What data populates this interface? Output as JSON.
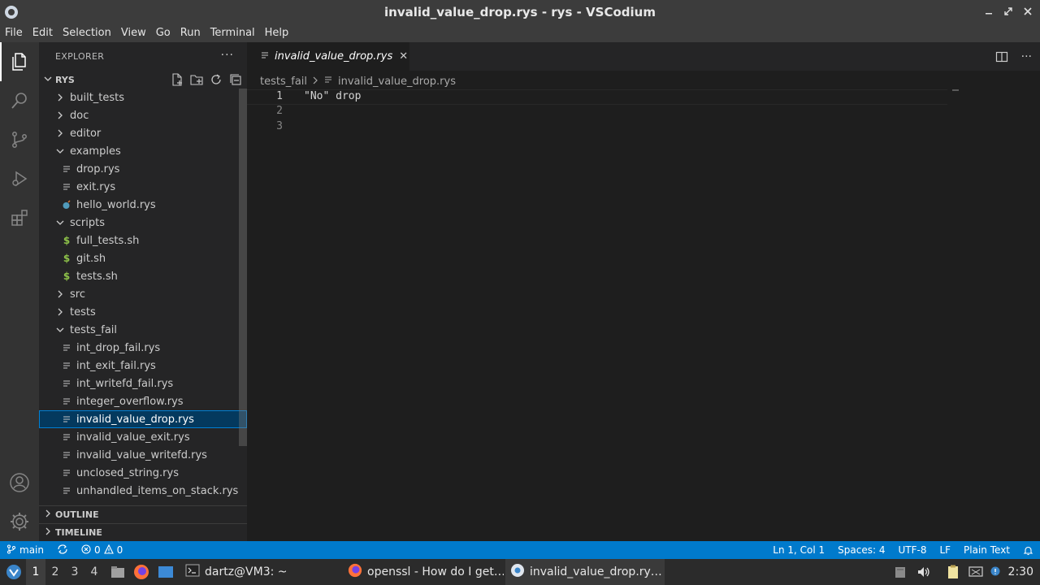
{
  "window": {
    "title": "invalid_value_drop.rys - rys - VSCodium",
    "controls": [
      "minimize",
      "maximize",
      "close"
    ]
  },
  "menu": [
    "File",
    "Edit",
    "Selection",
    "View",
    "Go",
    "Run",
    "Terminal",
    "Help"
  ],
  "activity_bar": {
    "top": [
      "files-icon",
      "search-icon",
      "source-control-icon",
      "run-debug-icon",
      "extensions-icon"
    ],
    "bottom": [
      "account-icon",
      "manage-gear-icon"
    ]
  },
  "explorer": {
    "header": "EXPLORER",
    "more": "···",
    "root": "RYS",
    "items": [
      {
        "label": "built_tests",
        "type": "folder",
        "expanded": false,
        "depth": 0
      },
      {
        "label": "doc",
        "type": "folder",
        "expanded": false,
        "depth": 0
      },
      {
        "label": "editor",
        "type": "folder",
        "expanded": false,
        "depth": 0
      },
      {
        "label": "examples",
        "type": "folder",
        "expanded": true,
        "depth": 0
      },
      {
        "label": "drop.rys",
        "type": "text",
        "depth": 1
      },
      {
        "label": "exit.rys",
        "type": "text",
        "depth": 1
      },
      {
        "label": "hello_world.rys",
        "type": "special",
        "depth": 1
      },
      {
        "label": "scripts",
        "type": "folder",
        "expanded": true,
        "depth": 0
      },
      {
        "label": "full_tests.sh",
        "type": "shell",
        "depth": 1
      },
      {
        "label": "git.sh",
        "type": "shell",
        "depth": 1
      },
      {
        "label": "tests.sh",
        "type": "shell",
        "depth": 1
      },
      {
        "label": "src",
        "type": "folder",
        "expanded": false,
        "depth": 0
      },
      {
        "label": "tests",
        "type": "folder",
        "expanded": false,
        "depth": 0
      },
      {
        "label": "tests_fail",
        "type": "folder",
        "expanded": true,
        "depth": 0
      },
      {
        "label": "int_drop_fail.rys",
        "type": "text",
        "depth": 1
      },
      {
        "label": "int_exit_fail.rys",
        "type": "text",
        "depth": 1
      },
      {
        "label": "int_writefd_fail.rys",
        "type": "text",
        "depth": 1
      },
      {
        "label": "integer_overflow.rys",
        "type": "text",
        "depth": 1
      },
      {
        "label": "invalid_value_drop.rys",
        "type": "text",
        "depth": 1,
        "selected": true
      },
      {
        "label": "invalid_value_exit.rys",
        "type": "text",
        "depth": 1
      },
      {
        "label": "invalid_value_writefd.rys",
        "type": "text",
        "depth": 1
      },
      {
        "label": "unclosed_string.rys",
        "type": "text",
        "depth": 1
      },
      {
        "label": "unhandled_items_on_stack.rys",
        "type": "text",
        "depth": 1
      }
    ],
    "sections": [
      "OUTLINE",
      "TIMELINE"
    ]
  },
  "editor": {
    "tab_label": "invalid_value_drop.rys",
    "breadcrumb": [
      "tests_fail",
      "invalid_value_drop.rys"
    ],
    "lines": [
      {
        "num": "1",
        "text": "\"No\" drop"
      },
      {
        "num": "2",
        "text": ""
      },
      {
        "num": "3",
        "text": ""
      }
    ]
  },
  "status": {
    "branch": "main",
    "errors": "0",
    "warnings": "0",
    "position": "Ln 1, Col 1",
    "spaces": "Spaces: 4",
    "encoding": "UTF-8",
    "eol": "LF",
    "language": "Plain Text"
  },
  "taskbar": {
    "workspaces": [
      "1",
      "2",
      "3",
      "4"
    ],
    "tasks": [
      {
        "label": "dartz@VM3: ~",
        "icon": "terminal-icon"
      },
      {
        "label": "openssl - How do I get…",
        "icon": "firefox-icon"
      },
      {
        "label": "invalid_value_drop.ry…",
        "icon": "vscodium-icon"
      }
    ],
    "clock": "2:30"
  },
  "colors": {
    "status_bar": "#007acc",
    "selection": "#04395e",
    "selection_border": "#007fd4",
    "shell_icon": "#8dc149",
    "special_icon": "#519aba"
  }
}
